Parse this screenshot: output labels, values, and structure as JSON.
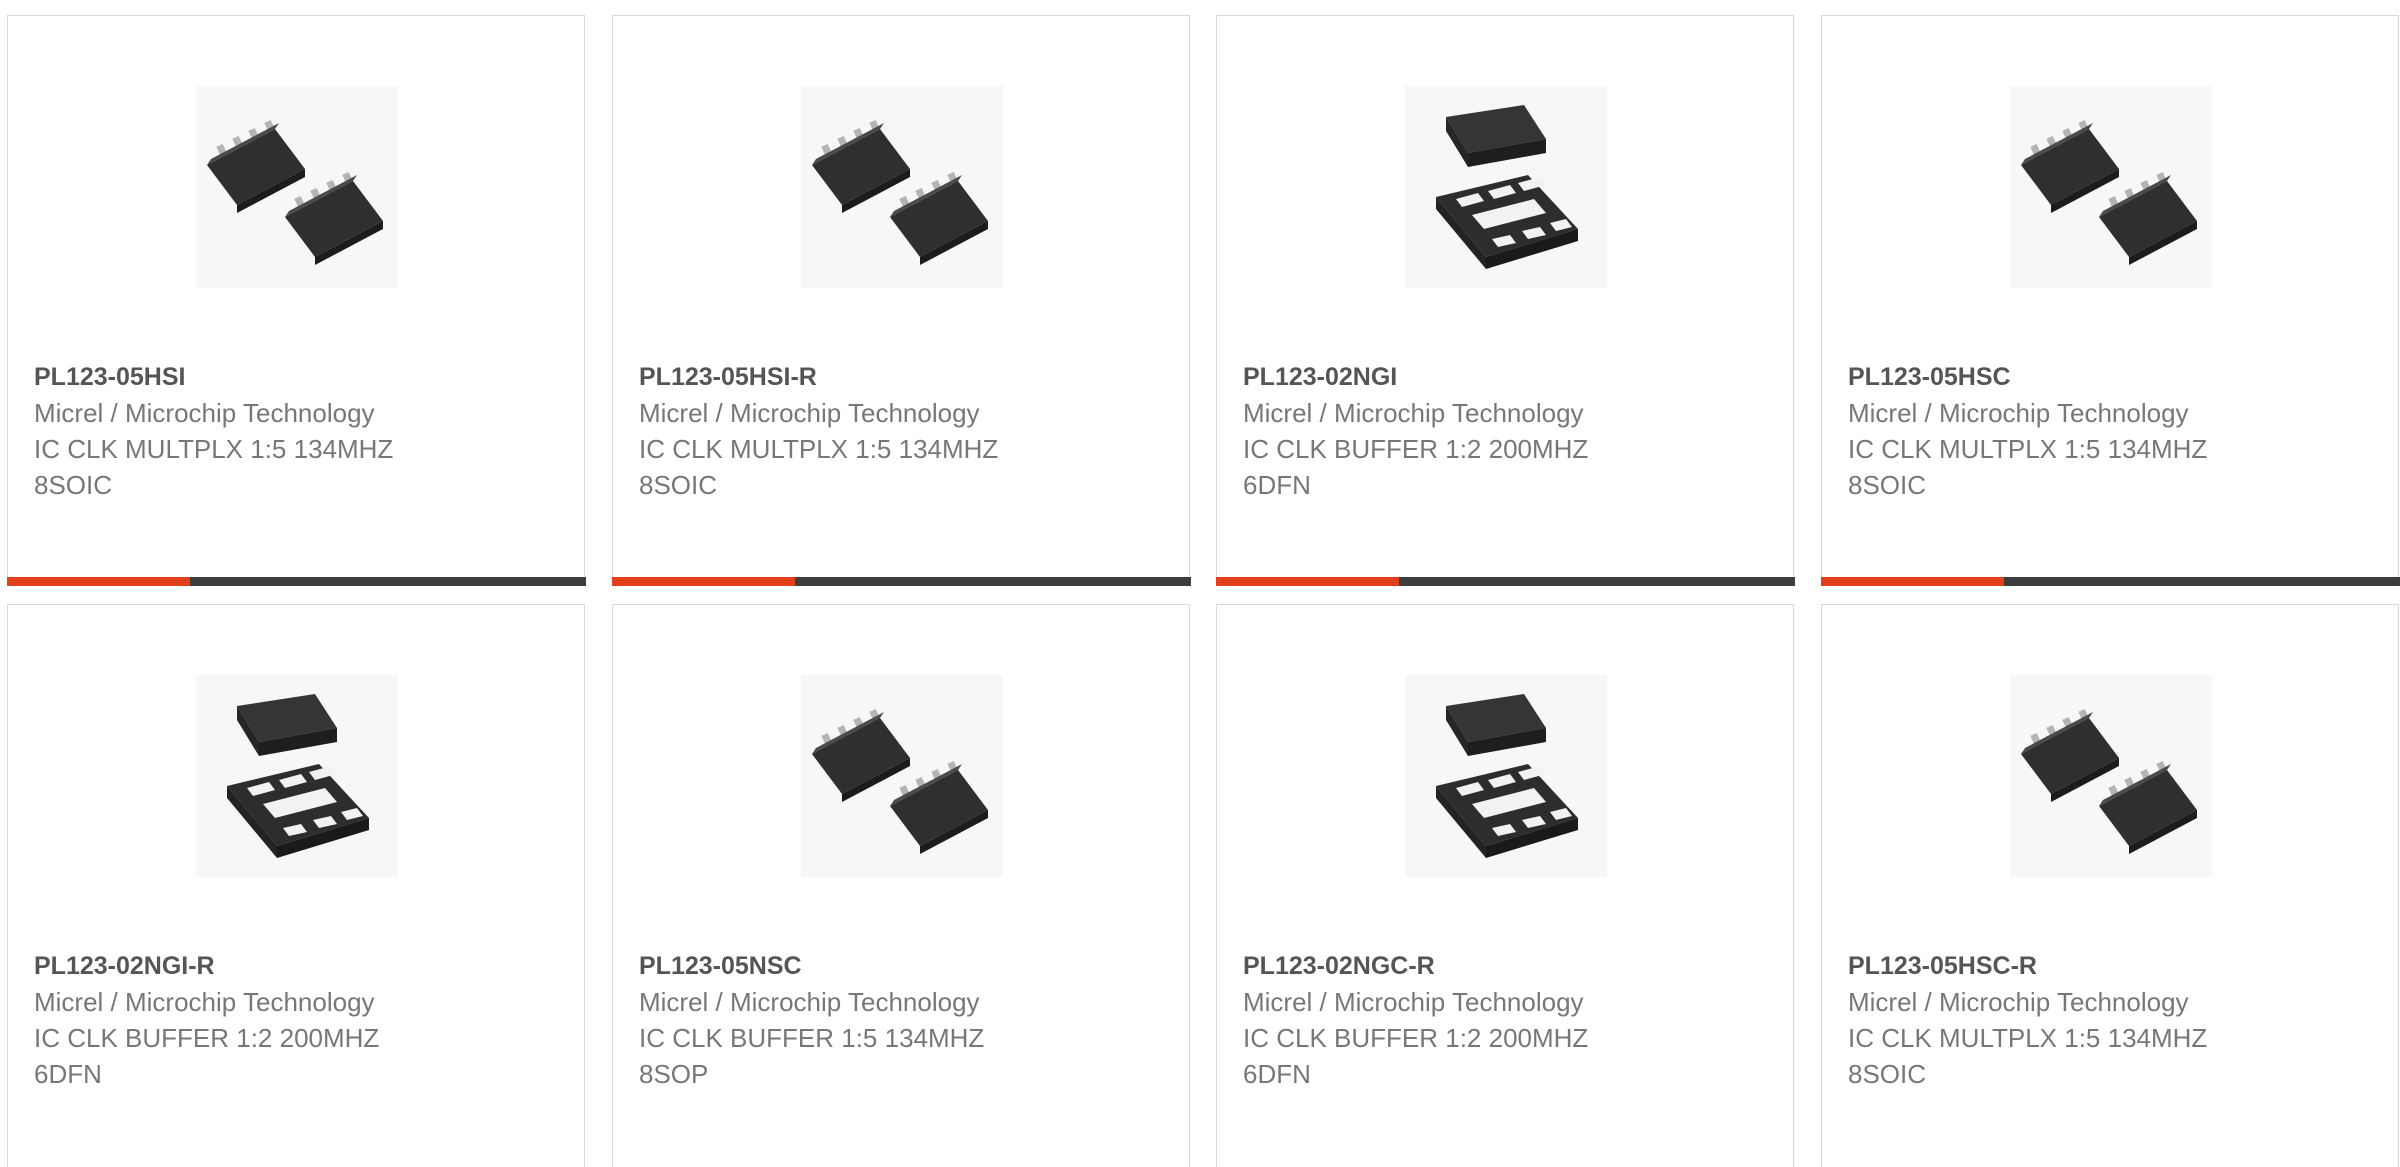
{
  "accent_color": "#e2401c",
  "bar_color": "#3d3d3d",
  "products": [
    {
      "part_number": "PL123-05HSI",
      "manufacturer": "Micrel / Microchip Technology",
      "desc_line1": "IC CLK MULTPLX 1:5 134MHZ",
      "desc_line2": "8SOIC",
      "package_icon": "soic-chip-icon"
    },
    {
      "part_number": "PL123-05HSI-R",
      "manufacturer": "Micrel / Microchip Technology",
      "desc_line1": "IC CLK MULTPLX 1:5 134MHZ",
      "desc_line2": "8SOIC",
      "package_icon": "soic-chip-icon"
    },
    {
      "part_number": "PL123-02NGI",
      "manufacturer": "Micrel / Microchip Technology",
      "desc_line1": "IC CLK BUFFER 1:2 200MHZ",
      "desc_line2": "6DFN",
      "package_icon": "dfn-chip-icon"
    },
    {
      "part_number": "PL123-05HSC",
      "manufacturer": "Micrel / Microchip Technology",
      "desc_line1": "IC CLK MULTPLX 1:5 134MHZ",
      "desc_line2": "8SOIC",
      "package_icon": "soic-chip-icon"
    },
    {
      "part_number": "PL123-02NGI-R",
      "manufacturer": "Micrel / Microchip Technology",
      "desc_line1": "IC CLK BUFFER 1:2 200MHZ",
      "desc_line2": "6DFN",
      "package_icon": "dfn-chip-icon"
    },
    {
      "part_number": "PL123-05NSC",
      "manufacturer": "Micrel / Microchip Technology",
      "desc_line1": "IC CLK BUFFER 1:5 134MHZ",
      "desc_line2": "8SOP",
      "package_icon": "soic-chip-icon"
    },
    {
      "part_number": "PL123-02NGC-R",
      "manufacturer": "Micrel / Microchip Technology",
      "desc_line1": "IC CLK BUFFER 1:2 200MHZ",
      "desc_line2": "6DFN",
      "package_icon": "dfn-chip-icon"
    },
    {
      "part_number": "PL123-05HSC-R",
      "manufacturer": "Micrel / Microchip Technology",
      "desc_line1": "IC CLK MULTPLX 1:5 134MHZ",
      "desc_line2": "8SOIC",
      "package_icon": "soic-chip-icon"
    }
  ]
}
